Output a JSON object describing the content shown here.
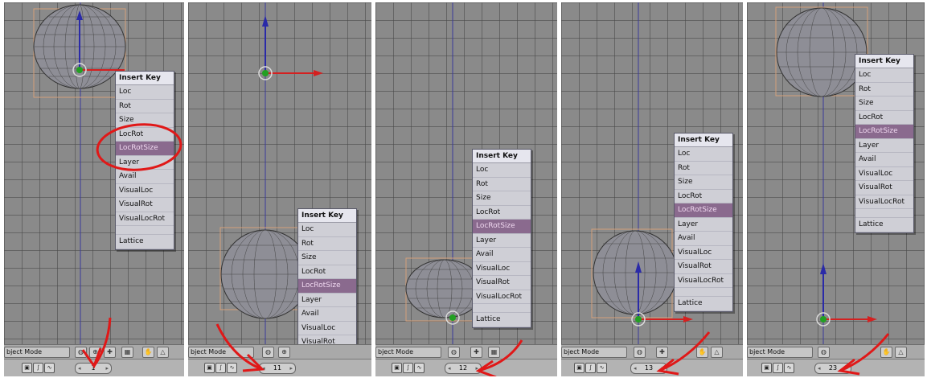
{
  "menu": {
    "title": "Insert Key",
    "items": [
      "Loc",
      "Rot",
      "Size",
      "LocRot",
      "LocRotSize",
      "Layer",
      "Avail",
      "VisualLoc",
      "VisualRot",
      "VisualLocRot",
      "",
      "Lattice"
    ]
  },
  "panels": [
    {
      "mode_label": "bject Mode",
      "frame": "1",
      "selected_item": "LocRotSize",
      "scale_label": ""
    },
    {
      "mode_label": "bject Mode",
      "frame": "11",
      "selected_item": "LocRotSize",
      "scale_label": ""
    },
    {
      "mode_label": "bject Mode",
      "frame": "12",
      "selected_item": "LocRotSize",
      "scale_label": ""
    },
    {
      "mode_label": "bject Mode",
      "frame": "13",
      "selected_item": "LocRotSize",
      "scale_label": ""
    },
    {
      "mode_label": "bject Mode",
      "frame": "23",
      "selected_item": "LocRotSize",
      "scale_label": ""
    }
  ],
  "colors": {
    "grid_bg": "#8a8a8a",
    "axis_y": "#2a2aa8",
    "axis_x": "#d42020",
    "center": "#22a022",
    "selection": "#8a6a8e",
    "annotation": "#e01818"
  },
  "icons": [
    "view-icon",
    "pivot-icon",
    "manipulator-icon",
    "layer-icon",
    "hand-icon",
    "camera-icon"
  ]
}
